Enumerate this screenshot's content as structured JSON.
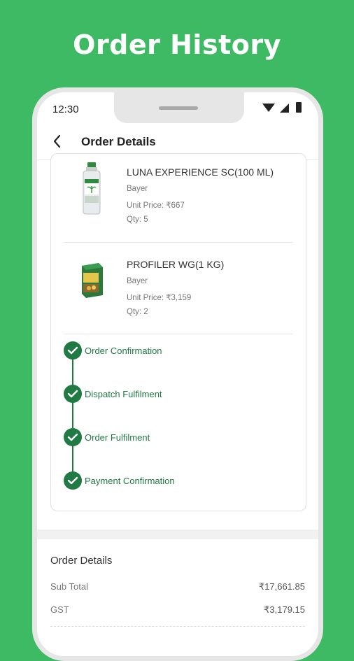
{
  "hero": {
    "title": "Order History"
  },
  "status_bar": {
    "time": "12:30"
  },
  "app_bar": {
    "title": "Order Details"
  },
  "products": [
    {
      "name": "LUNA EXPERIENCE SC(100 ML)",
      "brand": "Bayer",
      "unit_price": "Unit Price: ₹667",
      "qty": "Qty: 5",
      "image": "bottle"
    },
    {
      "name": "PROFILER WG(1 KG)",
      "brand": "Bayer",
      "unit_price": "Unit Price: ₹3,159",
      "qty": "Qty: 2",
      "image": "box"
    }
  ],
  "timeline": [
    {
      "label": "Order Confirmation"
    },
    {
      "label": "Dispatch Fulfilment"
    },
    {
      "label": "Order Fulfilment"
    },
    {
      "label": "Payment Confirmation"
    }
  ],
  "summary": {
    "title": "Order Details",
    "rows": [
      {
        "label": "Sub Total",
        "value": "₹17,661.85"
      },
      {
        "label": "GST",
        "value": "₹3,179.15"
      }
    ]
  },
  "colors": {
    "background": "#3dba63",
    "accent": "#1f7a43"
  }
}
